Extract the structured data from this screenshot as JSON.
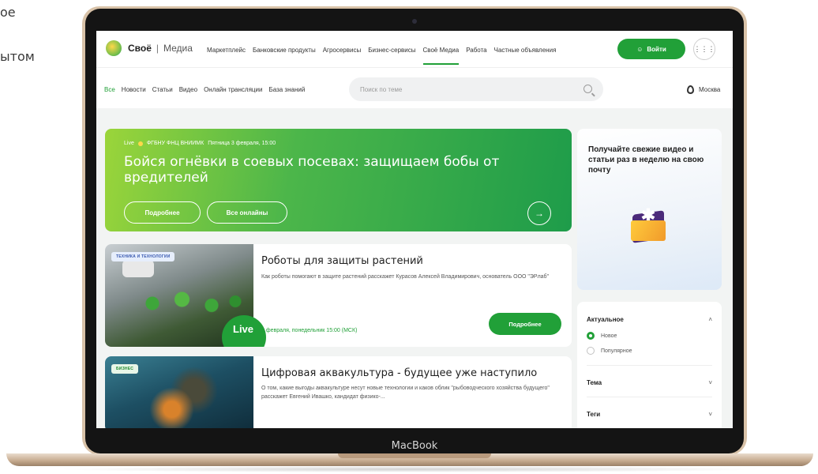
{
  "side_text": [
    "ое",
    "ытом"
  ],
  "device_label": "MacBook",
  "brand": {
    "name": "Своё",
    "separator": "|",
    "sub": "Медиа",
    "accent": "#21a038"
  },
  "main_nav": [
    "Маркетплейс",
    "Банковские продукты",
    "Агросервисы",
    "Бизнес-сервисы",
    "Своё Медиа",
    "Работа",
    "Частные объявления"
  ],
  "main_nav_active": "Своё Медиа",
  "login_label": "Войти",
  "sub_nav": [
    "Все",
    "Новости",
    "Статьи",
    "Видео",
    "Онлайн трансляции",
    "База знаний"
  ],
  "sub_nav_active": "Все",
  "search": {
    "placeholder": "Поиск по теме"
  },
  "city": "Москва",
  "hero": {
    "live": "Live",
    "org": "ФГБНУ ФНЦ ВНИИМК",
    "date": "Пятница 3 февраля, 15:00",
    "title": "Бойся огнёвки в соевых посевах: защищаем бобы от вредителей",
    "more_label": "Подробнее",
    "all_label": "Все онлайны"
  },
  "cards": [
    {
      "tag": "ТЕХНИКА И ТЕХНОЛОГИИ",
      "title": "Роботы для защиты растений",
      "desc": "Как роботы помогают в защите растений расскажет Курасов Алексей Владимирович, основатель ООО \"ЭРлаб\"",
      "live": "Live",
      "date": "6 февраля, понедельник 15:00 (МСК)",
      "button": "Подробнее"
    },
    {
      "tag": "БИЗНЕС",
      "title": "Цифровая аквакультура - будущее уже наступило",
      "desc": "О том, какие выгоды аквакультуре несут новые технологии и каков облик \"рыбоводческого хозяйства будущего\" расскажет Евгений Ивашко, кандидат физико-..."
    }
  ],
  "promo": {
    "text": "Получайте свежие видео и статьи раз в неделю на свою почту"
  },
  "filters": {
    "actual_label": "Актуальное",
    "options": [
      "Новое",
      "Популярное"
    ],
    "selected": "Новое",
    "theme_label": "Тема",
    "tags_label": "Теги"
  }
}
